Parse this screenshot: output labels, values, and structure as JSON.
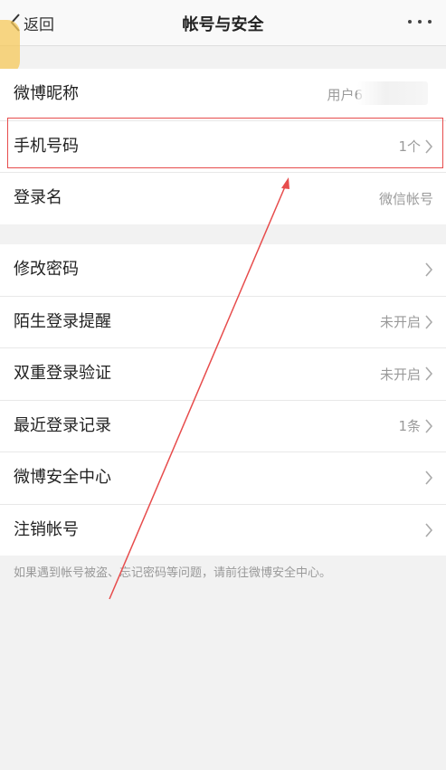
{
  "nav": {
    "back_label": "返回",
    "title": "帐号与安全"
  },
  "group1": [
    {
      "label": "微博昵称",
      "value": "用户6"
    },
    {
      "label": "手机号码",
      "value": "1个"
    },
    {
      "label": "登录名",
      "value": "微信帐号"
    }
  ],
  "group2": [
    {
      "label": "修改密码",
      "value": ""
    },
    {
      "label": "陌生登录提醒",
      "value": "未开启"
    },
    {
      "label": "双重登录验证",
      "value": "未开启"
    },
    {
      "label": "最近登录记录",
      "value": "1条"
    },
    {
      "label": "微博安全中心",
      "value": ""
    },
    {
      "label": "注销帐号",
      "value": ""
    }
  ],
  "footnote": "如果遇到帐号被盗、忘记密码等问题，请前往微博安全中心。",
  "colors": {
    "highlight": "#e74c4c",
    "arrow": "#e74c4c",
    "background": "#f2f2f2"
  },
  "icons": {
    "back": "chevron-left-icon",
    "more": "more-dots-icon",
    "row_chevron": "chevron-right-icon"
  }
}
